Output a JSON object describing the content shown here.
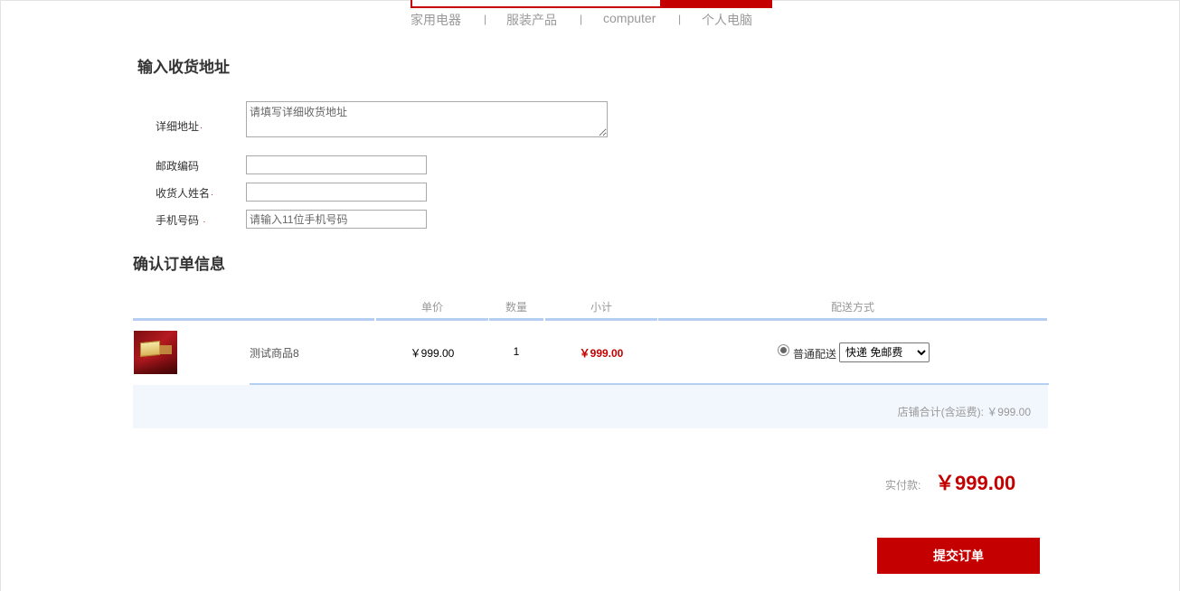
{
  "nav": {
    "links": [
      "家用电器",
      "服装产品",
      "computer",
      "个人电脑"
    ],
    "separator": "|"
  },
  "address": {
    "title": "输入收货地址",
    "detail_label": "详细地址",
    "detail_placeholder": "请填写详细收货地址",
    "postcode_label": "邮政编码",
    "postcode_value": "",
    "receiver_label": "收货人姓名",
    "receiver_value": "",
    "phone_label": "手机号码",
    "phone_placeholder": "请输入11位手机号码",
    "required_mark": "·"
  },
  "order": {
    "title": "确认订单信息",
    "headers": {
      "unit_price": "单价",
      "quantity": "数量",
      "subtotal": "小计",
      "shipping": "配送方式"
    },
    "item": {
      "name": "测试商品8",
      "unit_price": "￥999.00",
      "quantity": "1",
      "subtotal": "￥999.00",
      "shipping_option_label": "普通配送",
      "shipping_select_value": "快递 免邮费"
    },
    "shop_total": "店铺合计(含运费): ￥999.00"
  },
  "payment": {
    "label": "实付款:",
    "amount": "￥999.00"
  },
  "submit_label": "提交订单",
  "colors": {
    "accent": "#c40000",
    "table_line": "#b5cff2",
    "summary_bg": "#f2f6fd"
  }
}
